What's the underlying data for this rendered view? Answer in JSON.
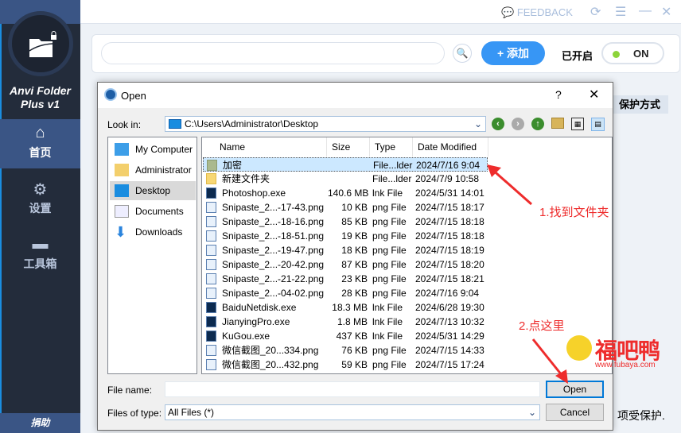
{
  "app": {
    "name": "Anvi Folder Plus v1"
  },
  "sidebar": {
    "items": [
      {
        "label": "首页",
        "icon": "home-icon"
      },
      {
        "label": "设置",
        "icon": "gear-icon"
      },
      {
        "label": "工具箱",
        "icon": "toolbox-icon"
      }
    ],
    "donate": "捐助"
  },
  "topbar": {
    "feedback": "FEEDBACK"
  },
  "toolbar": {
    "search_placeholder": "",
    "add_label": "+ 添加",
    "status_label": "已开启",
    "toggle": "ON",
    "toggle_color": "#8cd43a",
    "accent": "#3796f5"
  },
  "table": {
    "header": "保护方式",
    "footer_text": "项受保护."
  },
  "dialog": {
    "title": "Open",
    "help": "?",
    "close": "✕",
    "look_in_label": "Look in:",
    "look_in_value": "C:\\Users\\Administrator\\Desktop",
    "places": [
      "My Computer",
      "Administrator",
      "Desktop",
      "Documents",
      "Downloads"
    ],
    "selected_place": "Desktop",
    "columns": [
      "Name",
      "Size",
      "Type",
      "Date Modified"
    ],
    "files": [
      {
        "name": "加密",
        "size": "",
        "type": "File...lder",
        "date": "2024/7/16 9:04",
        "kind": "folder-g"
      },
      {
        "name": "新建文件夹",
        "size": "",
        "type": "File...lder",
        "date": "2024/7/9 10:58",
        "kind": "folder"
      },
      {
        "name": "Photoshop.exe",
        "size": "140.6 MB",
        "type": "lnk File",
        "date": "2024/5/31 14:01",
        "kind": "exe"
      },
      {
        "name": "Snipaste_2...-17-43.png",
        "size": "10 KB",
        "type": "png File",
        "date": "2024/7/15 18:17",
        "kind": "png"
      },
      {
        "name": "Snipaste_2...-18-16.png",
        "size": "85 KB",
        "type": "png File",
        "date": "2024/7/15 18:18",
        "kind": "png"
      },
      {
        "name": "Snipaste_2...-18-51.png",
        "size": "19 KB",
        "type": "png File",
        "date": "2024/7/15 18:18",
        "kind": "png"
      },
      {
        "name": "Snipaste_2...-19-47.png",
        "size": "18 KB",
        "type": "png File",
        "date": "2024/7/15 18:19",
        "kind": "png"
      },
      {
        "name": "Snipaste_2...-20-42.png",
        "size": "87 KB",
        "type": "png File",
        "date": "2024/7/15 18:20",
        "kind": "png"
      },
      {
        "name": "Snipaste_2...-21-22.png",
        "size": "23 KB",
        "type": "png File",
        "date": "2024/7/15 18:21",
        "kind": "png"
      },
      {
        "name": "Snipaste_2...-04-02.png",
        "size": "28 KB",
        "type": "png File",
        "date": "2024/7/16 9:04",
        "kind": "png"
      },
      {
        "name": "BaiduNetdisk.exe",
        "size": "18.3 MB",
        "type": "lnk File",
        "date": "2024/6/28 19:30",
        "kind": "exe"
      },
      {
        "name": "JianyingPro.exe",
        "size": "1.8 MB",
        "type": "lnk File",
        "date": "2024/7/13 10:32",
        "kind": "exe"
      },
      {
        "name": "KuGou.exe",
        "size": "437 KB",
        "type": "lnk File",
        "date": "2024/5/31 14:29",
        "kind": "exe"
      },
      {
        "name": "微信截图_20...334.png",
        "size": "76 KB",
        "type": "png File",
        "date": "2024/7/15 14:33",
        "kind": "png"
      },
      {
        "name": "微信截图_20...432.png",
        "size": "59 KB",
        "type": "png File",
        "date": "2024/7/15 17:24",
        "kind": "png"
      }
    ],
    "file_name_label": "File name:",
    "file_name_value": "",
    "file_type_label": "Files of type:",
    "file_type_value": "All Files (*)",
    "open_label": "Open",
    "cancel_label": "Cancel"
  },
  "annotations": {
    "step1": "1.找到文件夹",
    "step2": "2.点这里",
    "watermark": "福吧鸭",
    "watermark_url": "www.fubaya.com"
  }
}
